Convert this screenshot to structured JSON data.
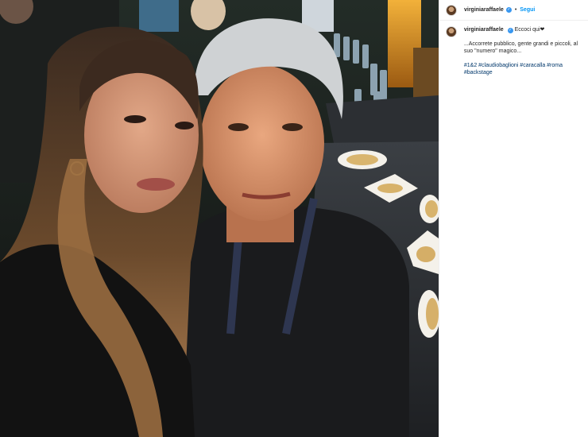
{
  "post": {
    "username": "virginiaraffaele",
    "verified_icon": "verified-badge-icon",
    "follow_label": "Segui",
    "separator": "•",
    "caption_title": "Eccoci qui❤",
    "caption_body": "...Accorrete pubblico, gente grandi e piccoli, al suo \"numero\" magico...",
    "hashtags": "#1&2 #claudiobaglioni #caracalla #roma #backstage"
  },
  "colors": {
    "link_blue": "#0095f6",
    "hashtag_blue": "#00376b",
    "text": "#262626",
    "divider": "#efefef"
  }
}
